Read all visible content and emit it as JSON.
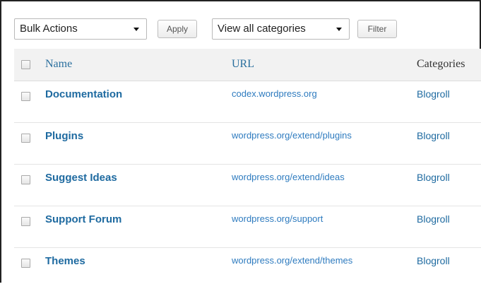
{
  "toolbar": {
    "bulk_actions": "Bulk Actions",
    "apply": "Apply",
    "view_categories": "View all categories",
    "filter": "Filter"
  },
  "table": {
    "headers": {
      "name": "Name",
      "url": "URL",
      "categories": "Categories"
    },
    "rows": [
      {
        "name": "Documentation",
        "url": "codex.wordpress.org",
        "category": "Blogroll"
      },
      {
        "name": "Plugins",
        "url": "wordpress.org/extend/plugins",
        "category": "Blogroll"
      },
      {
        "name": "Suggest Ideas",
        "url": "wordpress.org/extend/ideas",
        "category": "Blogroll"
      },
      {
        "name": "Support Forum",
        "url": "wordpress.org/support",
        "category": "Blogroll"
      },
      {
        "name": "Themes",
        "url": "wordpress.org/extend/themes",
        "category": "Blogroll"
      }
    ]
  },
  "colors": {
    "link": "#1e6aa0",
    "url_link": "#2e7bbf",
    "header_bg": "#f2f2f2",
    "header_name": "#2a6f9e",
    "header_text": "#333333"
  }
}
